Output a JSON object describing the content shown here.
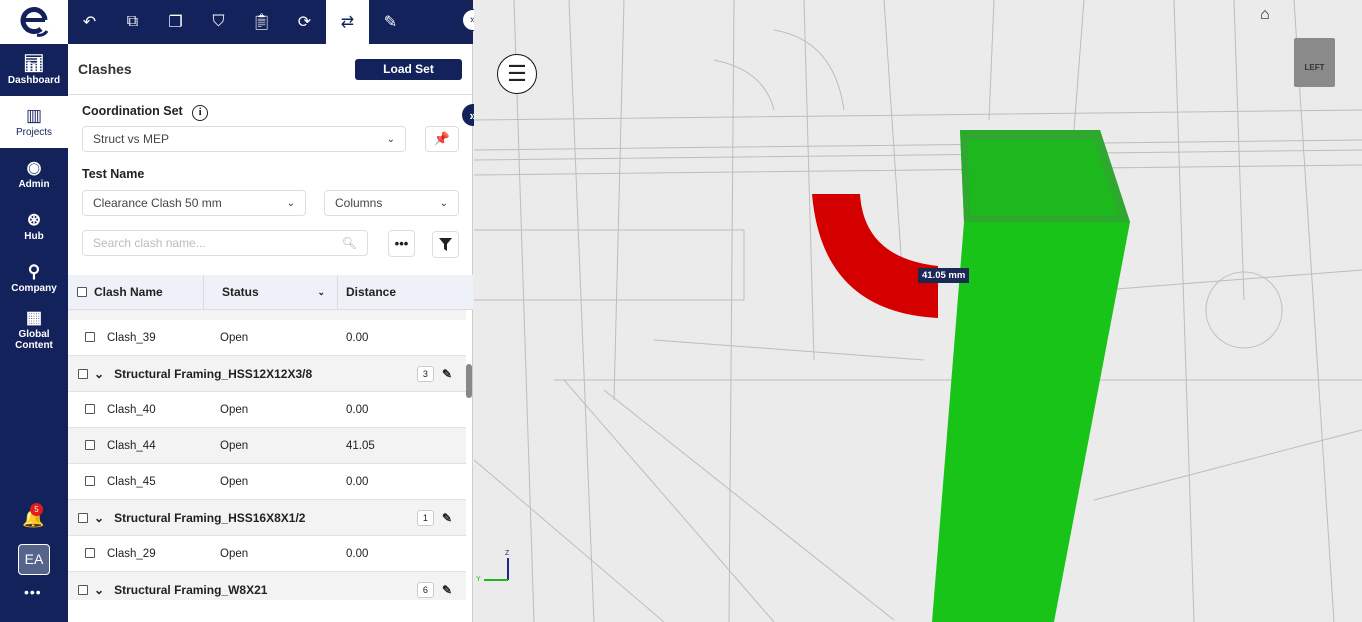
{
  "nav": {
    "items": [
      {
        "label": "Dashboard",
        "icon": "chart-icon"
      },
      {
        "label": "Projects",
        "icon": "buildings-icon"
      },
      {
        "label": "Admin",
        "icon": "admin-icon"
      },
      {
        "label": "Hub",
        "icon": "hub-icon"
      },
      {
        "label": "Company",
        "icon": "company-icon"
      },
      {
        "label": "Global Content",
        "icon": "global-content-icon"
      }
    ],
    "notifications": "5",
    "avatar": "EA"
  },
  "toolbar": {
    "icons": [
      "back-icon",
      "hierarchy-icon",
      "copy-icon",
      "shield-icon",
      "clipboard-icon",
      "sync-icon",
      "clash-icon",
      "markup-icon"
    ],
    "active": 6
  },
  "panel": {
    "title": "Clashes",
    "load_set": "Load Set",
    "coord_label": "Coordination Set",
    "coord_value": "Struct vs MEP",
    "test_label": "Test Name",
    "test_value": "Clearance Clash 50 mm",
    "columns_value": "Columns",
    "search_placeholder": "Search clash name..."
  },
  "table": {
    "headers": [
      "Clash Name",
      "Status",
      "Distance"
    ],
    "rows": [
      {
        "type": "item",
        "name": "Clash_39",
        "status": "Open",
        "distance": "0.00"
      },
      {
        "type": "group",
        "name": "Structural Framing_HSS12X12X3/8",
        "count": "3"
      },
      {
        "type": "item",
        "name": "Clash_40",
        "status": "Open",
        "distance": "0.00"
      },
      {
        "type": "item",
        "name": "Clash_44",
        "status": "Open",
        "distance": "41.05",
        "selected": true
      },
      {
        "type": "item",
        "name": "Clash_45",
        "status": "Open",
        "distance": "0.00"
      },
      {
        "type": "group",
        "name": "Structural Framing_HSS16X8X1/2",
        "count": "1"
      },
      {
        "type": "item",
        "name": "Clash_29",
        "status": "Open",
        "distance": "0.00"
      },
      {
        "type": "group",
        "name": "Structural Framing_W8X21",
        "count": "6"
      }
    ]
  },
  "viewport": {
    "measure": "41.05 mm",
    "viewcube": "LEFT",
    "axes": {
      "z": "Z",
      "y": "Y"
    },
    "colors": {
      "clash_red": "#d40000",
      "clash_green": "#19c419"
    }
  }
}
